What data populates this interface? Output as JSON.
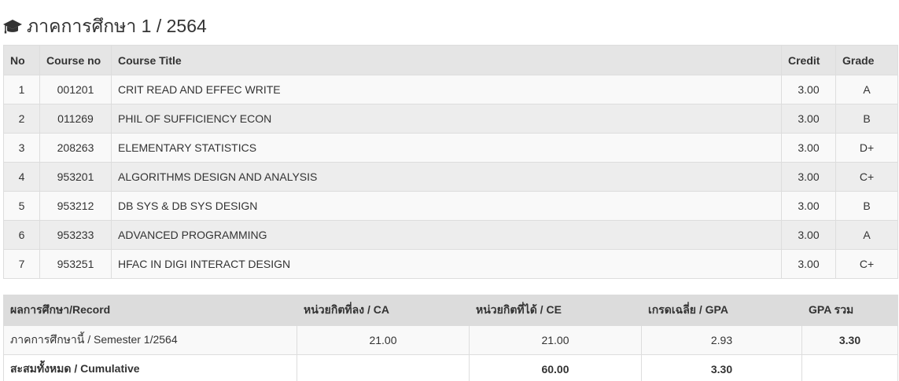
{
  "semester": {
    "icon": "graduation-cap-icon",
    "title": "ภาคการศึกษา 1 / 2564"
  },
  "courses": {
    "headers": {
      "no": "No",
      "course_no": "Course no",
      "course_title": "Course Title",
      "credit": "Credit",
      "grade": "Grade"
    },
    "rows": [
      {
        "no": "1",
        "course_no": "001201",
        "title": "CRIT READ AND EFFEC WRITE",
        "credit": "3.00",
        "grade": "A"
      },
      {
        "no": "2",
        "course_no": "011269",
        "title": "PHIL OF SUFFICIENCY ECON",
        "credit": "3.00",
        "grade": "B"
      },
      {
        "no": "3",
        "course_no": "208263",
        "title": "ELEMENTARY STATISTICS",
        "credit": "3.00",
        "grade": "D+"
      },
      {
        "no": "4",
        "course_no": "953201",
        "title": "ALGORITHMS DESIGN AND ANALYSIS",
        "credit": "3.00",
        "grade": "C+"
      },
      {
        "no": "5",
        "course_no": "953212",
        "title": "DB SYS & DB SYS DESIGN",
        "credit": "3.00",
        "grade": "B"
      },
      {
        "no": "6",
        "course_no": "953233",
        "title": "ADVANCED PROGRAMMING",
        "credit": "3.00",
        "grade": "A"
      },
      {
        "no": "7",
        "course_no": "953251",
        "title": "HFAC IN DIGI INTERACT DESIGN",
        "credit": "3.00",
        "grade": "C+"
      }
    ]
  },
  "summary": {
    "headers": {
      "record": "ผลการศึกษา/Record",
      "ca": "หน่วยกิตที่ลง / CA",
      "ce": "หน่วยกิตที่ได้ / CE",
      "gpa": "เกรดเฉลี่ย / GPA",
      "gpa_total": "GPA รวม"
    },
    "semester_row": {
      "label": "ภาคการศึกษานี้ / Semester 1/2564",
      "ca": "21.00",
      "ce": "21.00",
      "gpa": "2.93",
      "gpa_total": "3.30"
    },
    "cumulative_row": {
      "label": "สะสมทั้งหมด / Cumulative",
      "ca": "",
      "ce": "60.00",
      "gpa": "3.30",
      "gpa_total": ""
    }
  }
}
